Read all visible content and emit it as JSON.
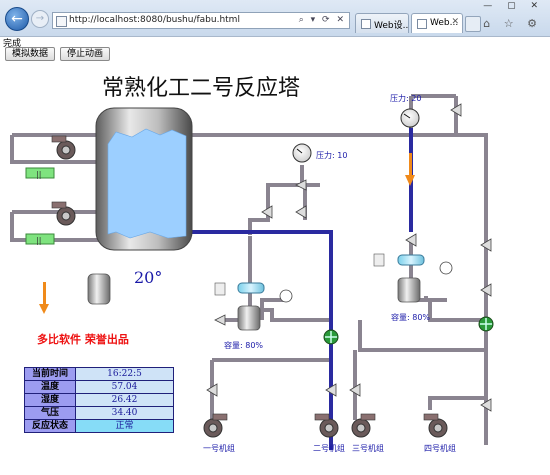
{
  "browser": {
    "url": "http://localhost:8080/bushu/fabu.html",
    "address_tools": "⌕ ▾ ⟳ ✕",
    "tabs": [
      {
        "label": "Web设..."
      },
      {
        "label": "Web..."
      }
    ],
    "window_buttons": "— ▢ ✕",
    "right_icons": "⌂ ☆ ⚙",
    "status": "完成"
  },
  "toolbar": {
    "simulate_label": "模拟数据",
    "stop_label": "停止动画"
  },
  "scada": {
    "title": "常熟化工二号反应塔",
    "pressure_top": "压力: 20",
    "pressure_mid": "压力: 10",
    "temperature": "20°",
    "capacity_left": "容量: 80%",
    "capacity_right": "容量: 80%",
    "brand": "多比软件 荣誉出品",
    "units": [
      "一号机组",
      "二号机组",
      "三号机组",
      "四号机组"
    ]
  },
  "info_table": [
    {
      "key": "当前时间",
      "value": "16:22:5"
    },
    {
      "key": "温度",
      "value": "57.04"
    },
    {
      "key": "湿度",
      "value": "26.42"
    },
    {
      "key": "气压",
      "value": "34.40"
    },
    {
      "key": "反应状态",
      "value": "正常"
    }
  ],
  "colors": {
    "pipe_gray": "#8a8490",
    "pipe_blue": "#2a2aa0",
    "liquid": "#9ccfff",
    "arrow_orange": "#f08a1a",
    "brand_red": "#ee1111"
  }
}
